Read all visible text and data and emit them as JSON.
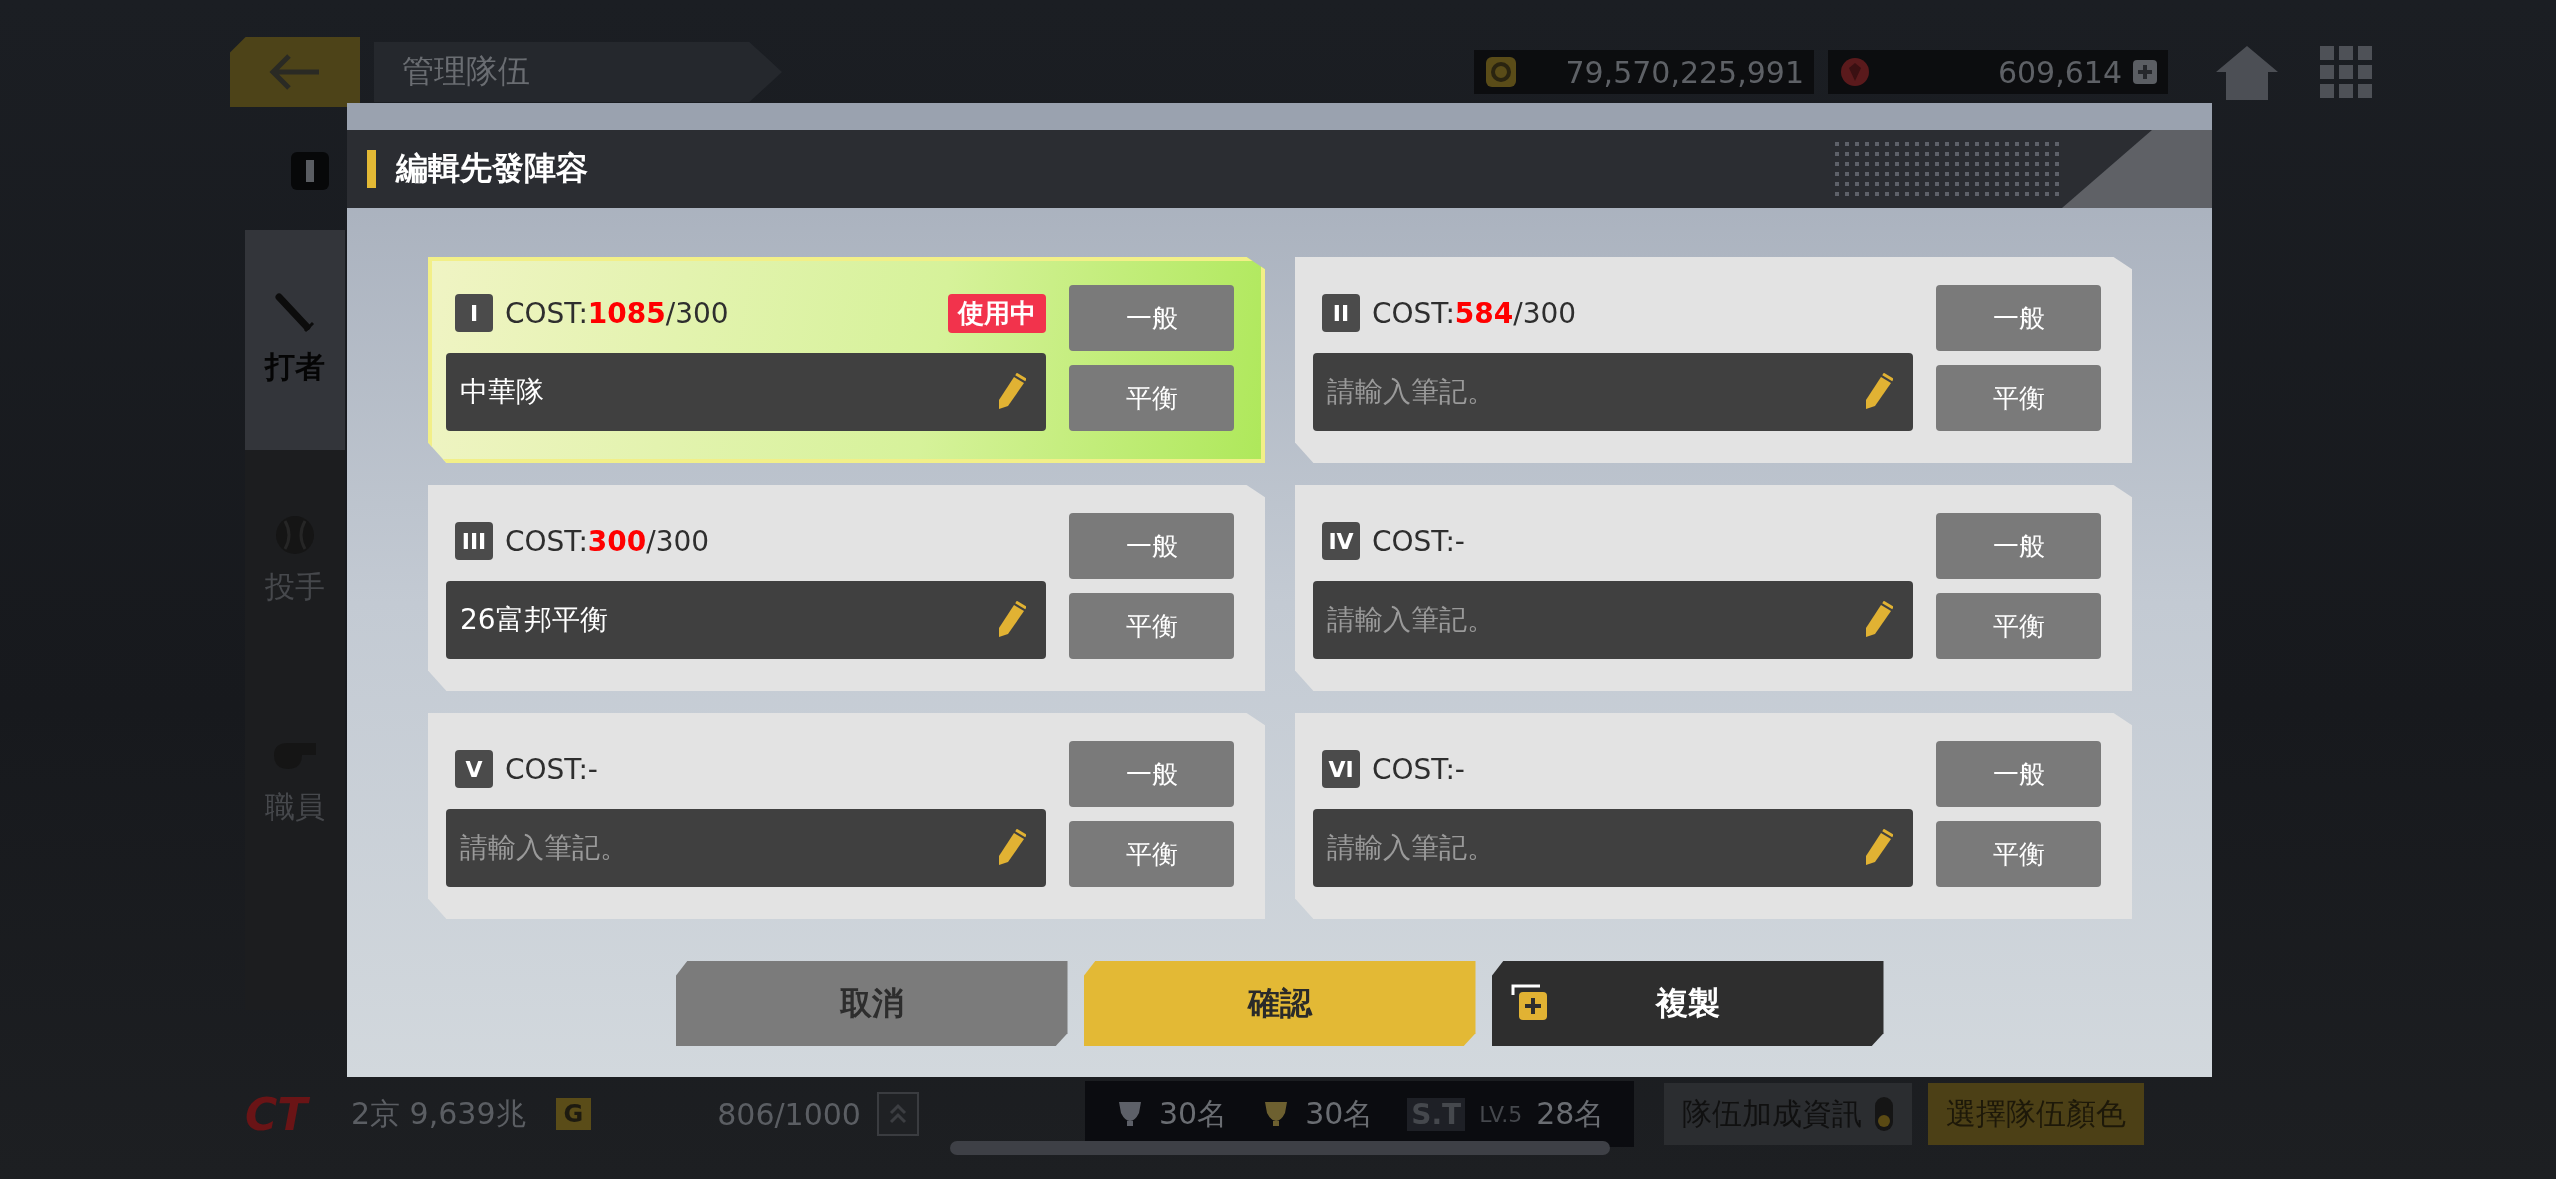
{
  "header": {
    "title": "管理隊伍"
  },
  "currencies": [
    {
      "kind": "gold",
      "amount": "79,570,225,991"
    },
    {
      "kind": "gem",
      "amount": "609,614"
    }
  ],
  "side_tabs": [
    {
      "label": "打者",
      "kind": "bat",
      "selected": true
    },
    {
      "label": "投手",
      "kind": "ball",
      "selected": false
    },
    {
      "label": "職員",
      "kind": "whistle",
      "selected": false
    }
  ],
  "footer": {
    "logo": "CT",
    "money": "2京 9,639兆",
    "money_badge": "G",
    "card_count": "806/1000",
    "ranks": [
      {
        "kind": "silver",
        "rank": "30名"
      },
      {
        "kind": "gold",
        "rank": "30名"
      },
      {
        "kind": "team",
        "tag": "S.T",
        "tier": "LV.5",
        "rank": "28名"
      }
    ],
    "buttons": [
      {
        "label": "隊伍加成資訊",
        "kind": "toggle"
      },
      {
        "label": "選擇隊伍顏色",
        "kind": "color"
      }
    ]
  },
  "dialog": {
    "title": "編輯先發陣容",
    "lineups": [
      {
        "numeral": "I",
        "cost_label": "COST:",
        "cost": "1085",
        "cost_limit": "/300",
        "over": true,
        "in_use": true,
        "badge": "使用中",
        "value": "中華隊",
        "buttons": [
          "一般",
          "平衡"
        ]
      },
      {
        "numeral": "II",
        "cost_label": "COST:",
        "cost": "584",
        "cost_limit": "/300",
        "over": true,
        "in_use": false,
        "placeholder": "請輸入筆記。",
        "buttons": [
          "一般",
          "平衡"
        ]
      },
      {
        "numeral": "III",
        "cost_label": "COST:",
        "cost": "300",
        "cost_limit": "/300",
        "over": true,
        "in_use": false,
        "value": "26富邦平衡",
        "buttons": [
          "一般",
          "平衡"
        ]
      },
      {
        "numeral": "IV",
        "cost_label": "COST:",
        "cost": "-",
        "over": false,
        "in_use": false,
        "placeholder": "請輸入筆記。",
        "buttons": [
          "一般",
          "平衡"
        ]
      },
      {
        "numeral": "V",
        "cost_label": "COST:",
        "cost": "-",
        "over": false,
        "in_use": false,
        "placeholder": "請輸入筆記。",
        "buttons": [
          "一般",
          "平衡"
        ]
      },
      {
        "numeral": "VI",
        "cost_label": "COST:",
        "cost": "-",
        "over": false,
        "in_use": false,
        "placeholder": "請輸入筆記。",
        "buttons": [
          "一般",
          "平衡"
        ]
      }
    ],
    "actions": [
      {
        "label": "取消",
        "kind": "cancel"
      },
      {
        "label": "確認",
        "kind": "confirm"
      },
      {
        "label": "複製",
        "kind": "copy"
      }
    ]
  }
}
